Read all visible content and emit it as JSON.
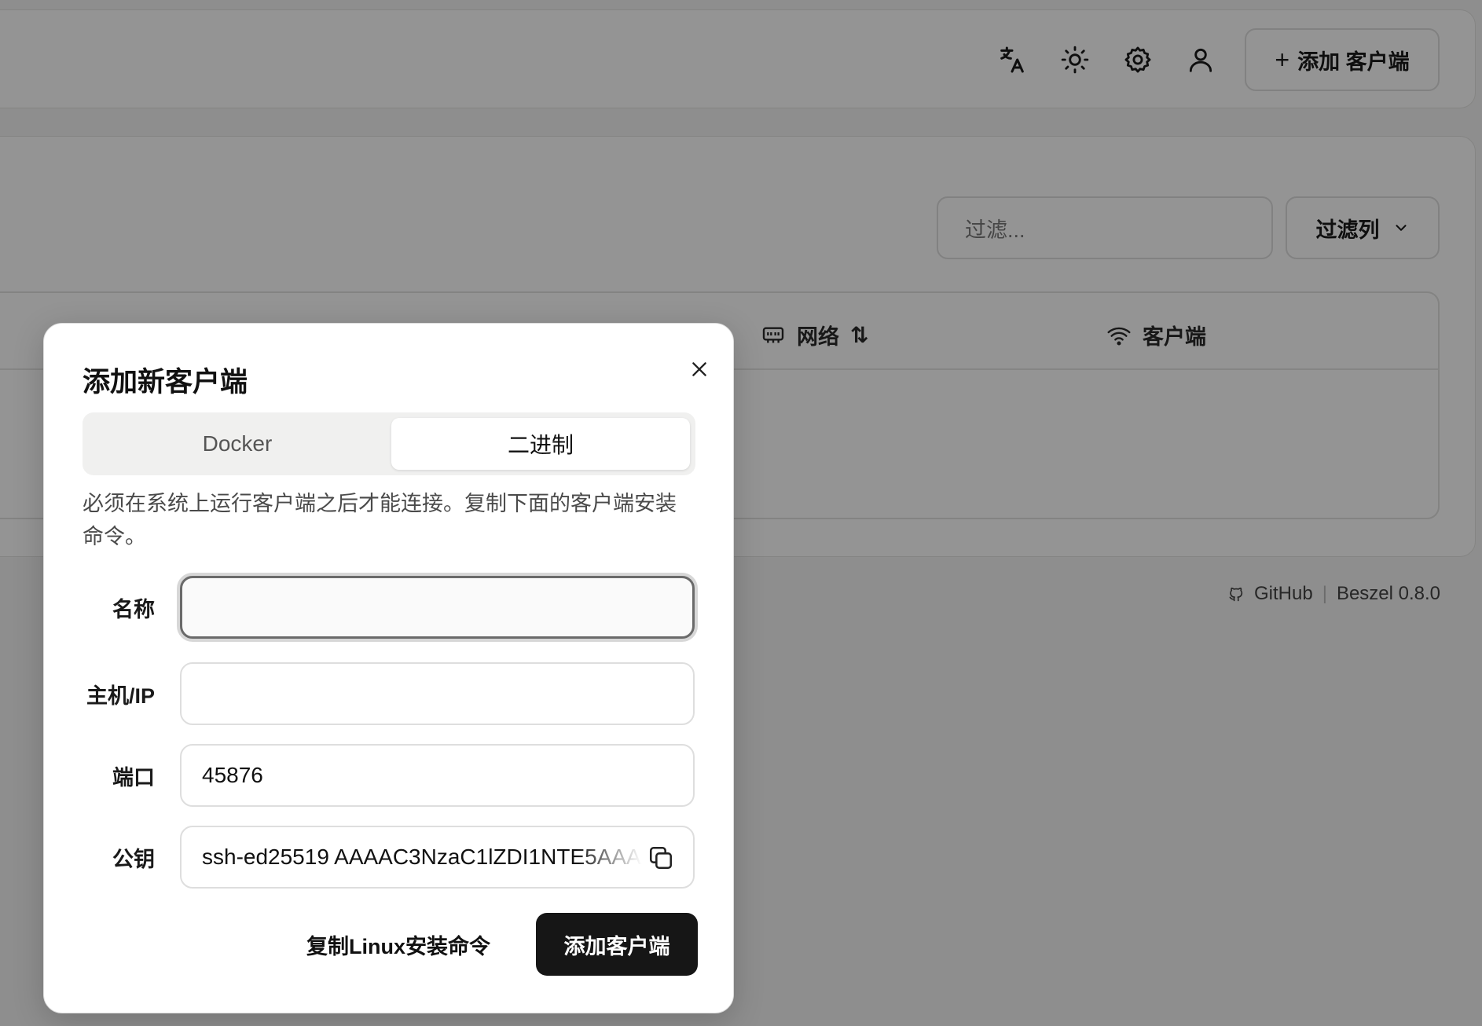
{
  "header": {
    "icons": [
      "translate-icon",
      "sun-icon",
      "gear-icon",
      "user-icon"
    ],
    "add_client_label": "添加 客户端"
  },
  "toolbar": {
    "filter_placeholder": "过滤...",
    "filter_columns_label": "过滤列"
  },
  "table": {
    "columns": [
      {
        "label": "网络",
        "icon": "network-icon"
      },
      {
        "label": "客户端",
        "icon": "wifi-icon"
      }
    ]
  },
  "footer": {
    "github_label": "GitHub",
    "version_label": "Beszel 0.8.0"
  },
  "dialog": {
    "title": "添加新客户端",
    "tabs": [
      {
        "label": "Docker",
        "active": false
      },
      {
        "label": "二进制",
        "active": true
      }
    ],
    "description": "必须在系统上运行客户端之后才能连接。复制下面的客户端安装命令。",
    "fields": {
      "name": {
        "label": "名称",
        "value": ""
      },
      "host": {
        "label": "主机/IP",
        "value": ""
      },
      "port": {
        "label": "端口",
        "value": "45876"
      },
      "public_key": {
        "label": "公钥",
        "value": "ssh-ed25519 AAAAC3NzaC1lZDI1NTE5AAAA"
      }
    },
    "copy_linux_label": "复制Linux安装命令",
    "submit_label": "添加客户端"
  }
}
